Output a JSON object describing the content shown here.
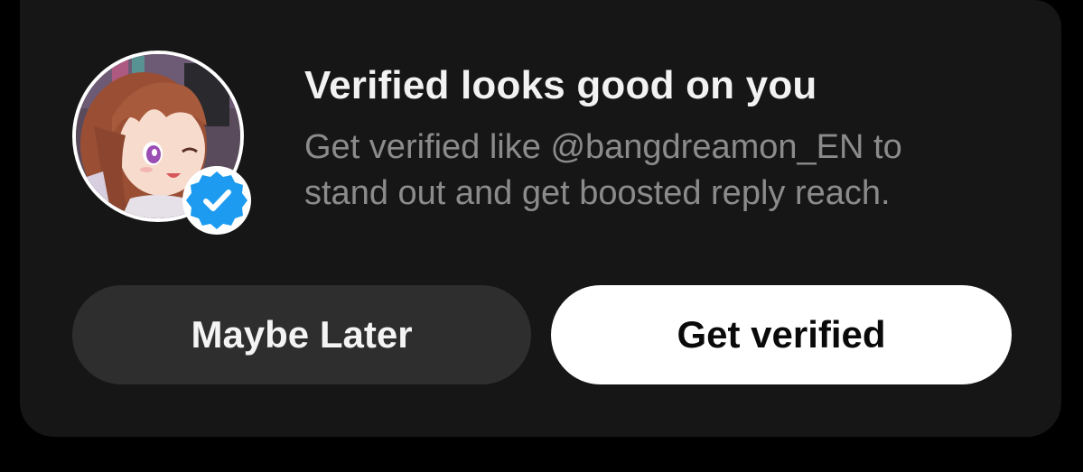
{
  "prompt": {
    "title": "Verified looks good on you",
    "subtitle": "Get verified like @bangdreamon_EN to stand out and get boosted reply reach.",
    "avatar_icon": "anime-avatar",
    "badge_icon": "verified-badge-icon"
  },
  "buttons": {
    "maybe_later": "Maybe Later",
    "get_verified": "Get verified"
  },
  "colors": {
    "card_background": "#161616",
    "badge_blue": "#1d9bf0",
    "secondary_button": "#2e2e2e",
    "primary_button": "#ffffff"
  }
}
